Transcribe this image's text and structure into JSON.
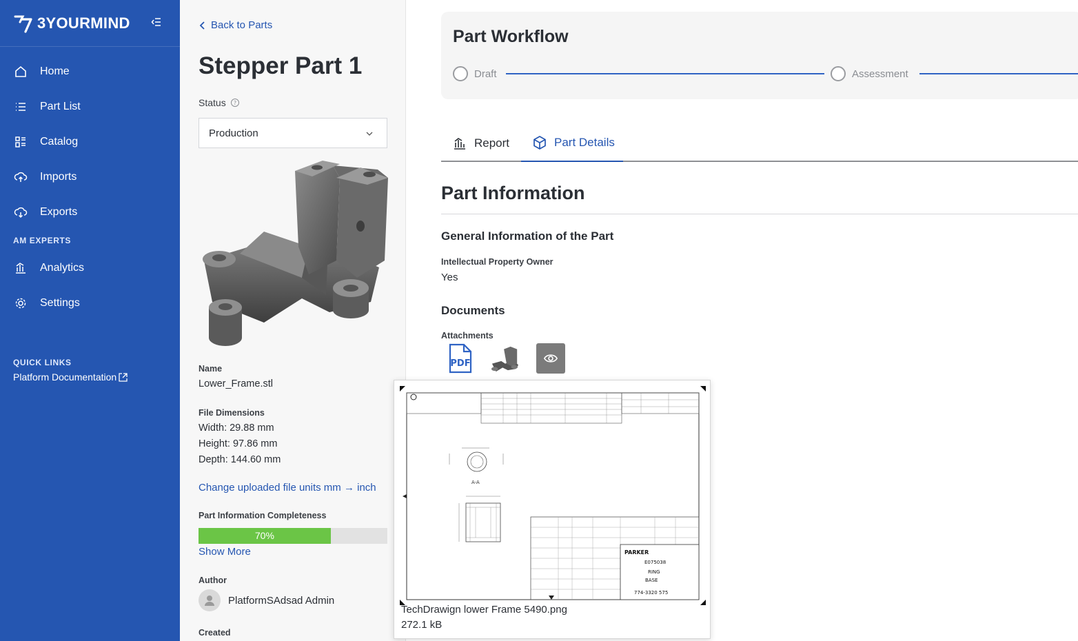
{
  "brand": {
    "name": "3YOURMIND"
  },
  "sidebar": {
    "items": [
      {
        "label": "Home",
        "icon": "home-icon"
      },
      {
        "label": "Part List",
        "icon": "list-icon"
      },
      {
        "label": "Catalog",
        "icon": "catalog-icon"
      },
      {
        "label": "Imports",
        "icon": "cloud-upload-icon"
      },
      {
        "label": "Exports",
        "icon": "cloud-download-icon"
      }
    ],
    "section_am": "AM EXPERTS",
    "am_items": [
      {
        "label": "Analytics",
        "icon": "analytics-icon"
      },
      {
        "label": "Settings",
        "icon": "gear-icon"
      }
    ],
    "quick_links_title": "QUICK LINKS",
    "quick_link": "Platform Documentation"
  },
  "part": {
    "back_label": "Back to Parts",
    "title": "Stepper Part 1",
    "status_label": "Status",
    "status_value": "Production",
    "name_label": "Name",
    "name_value": "Lower_Frame.stl",
    "dims_label": "File Dimensions",
    "width": "Width: 29.88 mm",
    "height": "Height: 97.86 mm",
    "depth": "Depth: 144.60 mm",
    "units_link": "Change uploaded file units mm → inch",
    "completeness_label": "Part Information Completeness",
    "completeness_pct": 0.7,
    "completeness_text": "70%",
    "show_more": "Show More",
    "author_label": "Author",
    "author_name": "PlatformSAdsad Admin",
    "created_label": "Created"
  },
  "workflow": {
    "title": "Part Workflow",
    "steps": [
      "Draft",
      "Assessment"
    ]
  },
  "tabs": {
    "report": "Report",
    "details": "Part Details"
  },
  "info": {
    "title": "Part Information",
    "general_title": "General Information of the Part",
    "ip_label": "Intellectual Property Owner",
    "ip_value": "Yes",
    "documents_title": "Documents",
    "attachments_label": "Attachments"
  },
  "preview": {
    "file_name": "TechDrawign lower Frame 5490.png",
    "file_size": "272.1 kB"
  },
  "colors": {
    "sidebar": "#2556b1",
    "accent": "#2556b1",
    "progress": "#6bc546"
  }
}
